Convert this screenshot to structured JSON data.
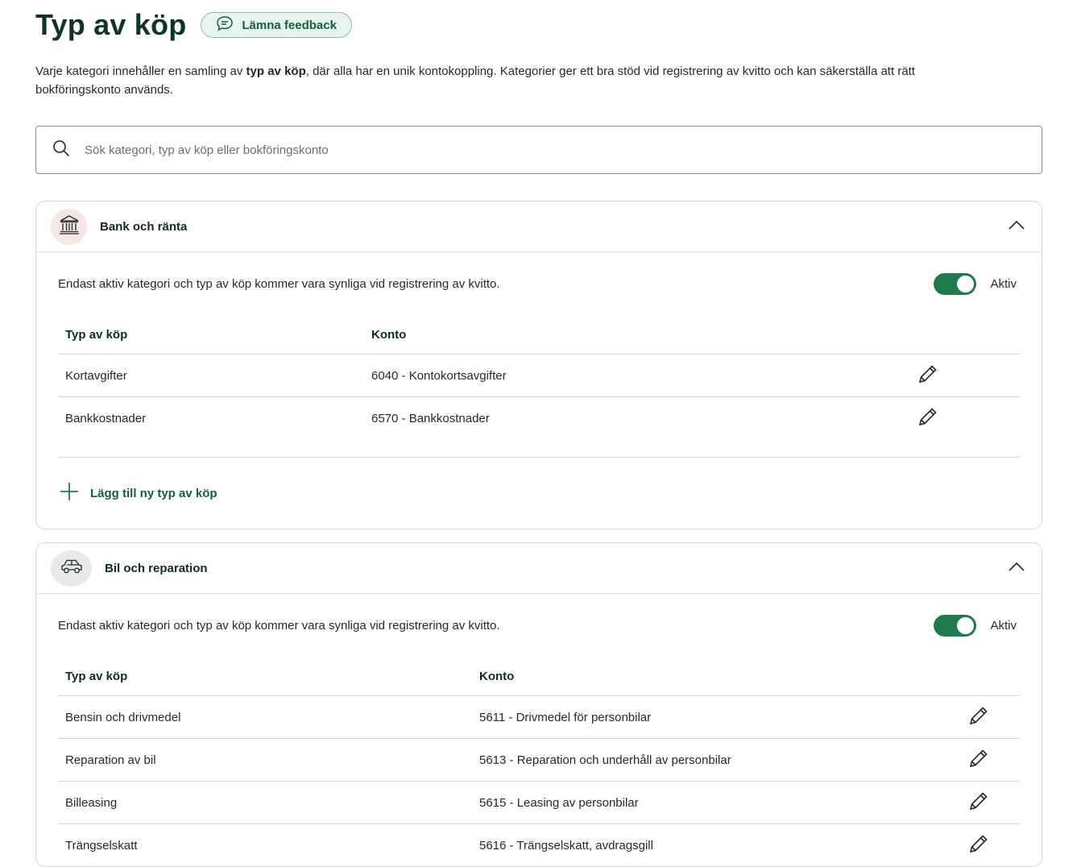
{
  "header": {
    "title": "Typ av köp",
    "feedback_label": "Lämna feedback"
  },
  "intro": {
    "text_before": "Varje kategori innehåller en samling av ",
    "text_bold": "typ av köp",
    "text_after": ", där alla har en unik kontokoppling. Kategorier ger ett bra stöd vid registrering av kvitto och kan säkerställa att rätt bokföringskonto används."
  },
  "search": {
    "placeholder": "Sök kategori, typ av köp eller bokföringskonto",
    "value": ""
  },
  "categories": [
    {
      "name": "Bank och ränta",
      "icon": "bank-icon",
      "icon_bg": "#f6e6e6",
      "expanded": true,
      "active_text": "Endast aktiv kategori och typ av köp kommer vara synliga vid registrering av kvitto.",
      "active_label": "Aktiv",
      "active": true,
      "columns": [
        "Typ av köp",
        "Konto"
      ],
      "rows": [
        {
          "type": "Kortavgifter",
          "account": "6040 - Kontokortsavgifter"
        },
        {
          "type": "Bankkostnader",
          "account": "6570 - Bankkostnader"
        }
      ],
      "add_label": "Lägg till ny typ av köp"
    },
    {
      "name": "Bil och reparation",
      "icon": "car-icon",
      "icon_bg": "#e8e9ea",
      "expanded": true,
      "active_text": "Endast aktiv kategori och typ av köp kommer vara synliga vid registrering av kvitto.",
      "active_label": "Aktiv",
      "active": true,
      "columns": [
        "Typ av köp",
        "Konto"
      ],
      "rows": [
        {
          "type": "Bensin och drivmedel",
          "account": "5611 - Drivmedel för personbilar"
        },
        {
          "type": "Reparation av bil",
          "account": "5613 - Reparation och underhåll av personbilar"
        },
        {
          "type": "Billeasing",
          "account": "5615 - Leasing av personbilar"
        },
        {
          "type": "Trängselskatt",
          "account": "5616 - Trängselskatt, avdragsgill"
        }
      ]
    }
  ],
  "colors": {
    "title": "#0f3526",
    "accent": "#1f7a4c",
    "feedback_bg": "#e8f4ee"
  }
}
